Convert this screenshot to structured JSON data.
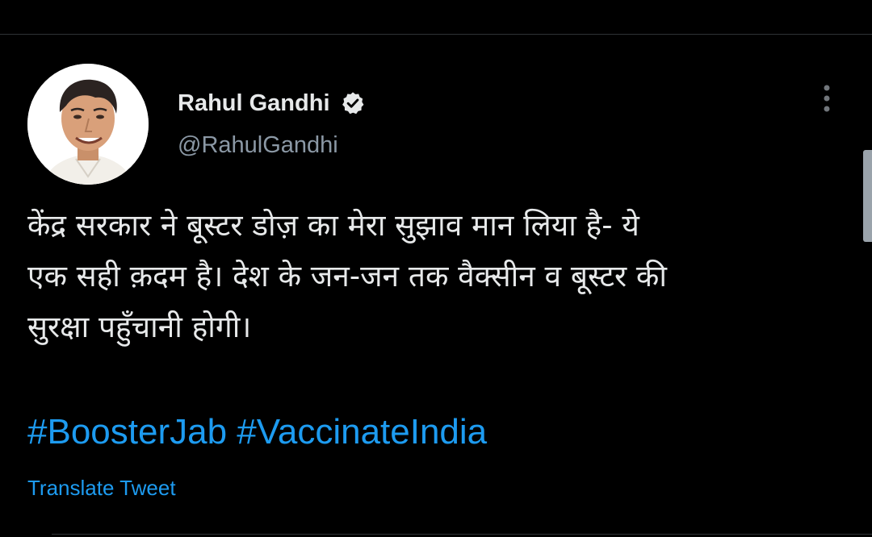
{
  "user": {
    "display_name": "Rahul Gandhi",
    "handle": "@RahulGandhi",
    "verified_icon": "verified-badge-icon",
    "avatar": "profile-photo"
  },
  "tweet": {
    "text_lines": [
      "केंद्र सरकार ने बूस्टर डोज़ का मेरा सुझाव मान लिया है- ये",
      "एक सही क़दम है। देश के जन-जन तक वैक्सीन व बूस्टर की",
      "सुरक्षा पहुँचानी होगी।"
    ],
    "hashtags": [
      "#BoosterJab",
      "#VaccinateIndia"
    ],
    "translate_label": "Translate Tweet"
  },
  "actions": {
    "more_icon": "more-vertical-icon"
  },
  "colors": {
    "background": "#000000",
    "text": "#e7e9ea",
    "secondary_text": "#8b98a5",
    "link": "#1d9bf0",
    "divider": "#2f3336"
  }
}
